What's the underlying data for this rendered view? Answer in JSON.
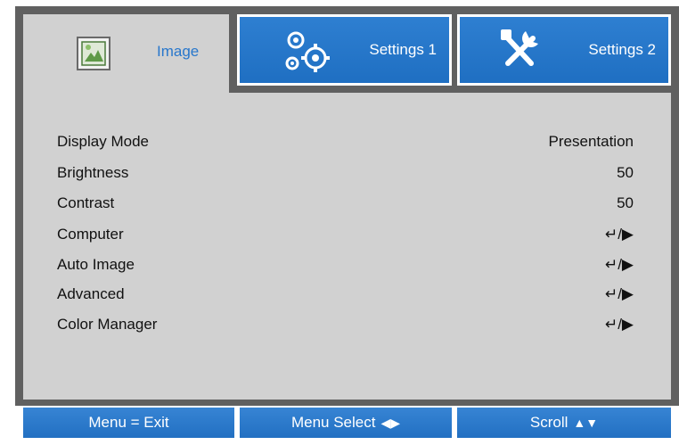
{
  "tabs": [
    {
      "label": "Image",
      "icon": "image-icon",
      "active": true
    },
    {
      "label": "Settings 1",
      "icon": "gears-icon",
      "active": false
    },
    {
      "label": "Settings 2",
      "icon": "tools-icon",
      "active": false
    }
  ],
  "menu": [
    {
      "label": "Display Mode",
      "value": "Presentation"
    },
    {
      "label": "Brightness",
      "value": "50"
    },
    {
      "label": "Contrast",
      "value": "50"
    },
    {
      "label": "Computer",
      "value": "↵/▶"
    },
    {
      "label": "Auto Image",
      "value": "↵/▶"
    },
    {
      "label": "Advanced",
      "value": "↵/▶"
    },
    {
      "label": "Color Manager",
      "value": "↵/▶"
    }
  ],
  "footer": {
    "exit": "Menu = Exit",
    "select": "Menu Select",
    "select_glyph": "◀▶",
    "scroll": "Scroll",
    "scroll_glyph": "▲▼"
  },
  "colors": {
    "accent_blue": "#2877cc",
    "panel_grey": "#d1d1d1",
    "frame_dark": "#606060"
  }
}
